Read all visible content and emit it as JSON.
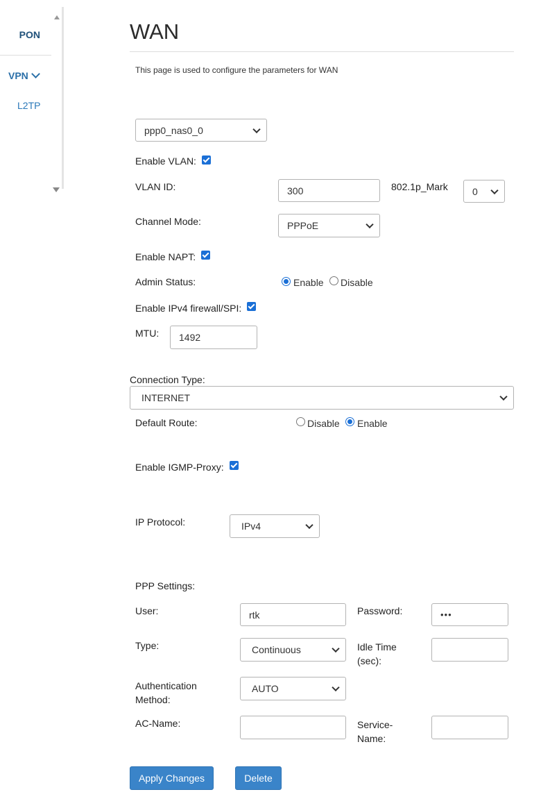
{
  "sidebar": {
    "pon": "PON",
    "vpn": "VPN",
    "l2tp": "L2TP"
  },
  "page": {
    "title": "WAN",
    "description": "This page is used to configure the parameters for WAN"
  },
  "form": {
    "wan_interface": "ppp0_nas0_0",
    "enable_vlan_label": "Enable VLAN:",
    "enable_vlan": true,
    "vlan_id_label": "VLAN ID:",
    "vlan_id": "300",
    "mark_label": "802.1p_Mark",
    "mark": "0",
    "channel_mode_label": "Channel Mode:",
    "channel_mode": "PPPoE",
    "enable_napt_label": "Enable NAPT:",
    "enable_napt": true,
    "admin_status_label": "Admin Status:",
    "admin_enable": "Enable",
    "admin_disable": "Disable",
    "enable_firewall_label": "Enable IPv4 firewall/SPI:",
    "enable_firewall": true,
    "mtu_label": "MTU:",
    "mtu": "1492",
    "connection_type_label": "Connection Type:",
    "connection_type": "INTERNET",
    "default_route_label": "Default Route:",
    "default_route_disable": "Disable",
    "default_route_enable": "Enable",
    "igmp_label": "Enable IGMP-Proxy:",
    "igmp": true,
    "ip_protocol_label": "IP Protocol:",
    "ip_protocol": "IPv4"
  },
  "ppp": {
    "section_label": "PPP Settings:",
    "user_label": "User:",
    "user": "rtk",
    "password_label": "Password:",
    "password_mask": "•••",
    "type_label": "Type:",
    "type": "Continuous",
    "idle_time_label_1": "Idle Time",
    "idle_time_label_2": "(sec):",
    "idle_time": "",
    "auth_label_1": "Authentication",
    "auth_label_2": "Method:",
    "auth": "AUTO",
    "ac_name_label": "AC-Name:",
    "ac_name": "",
    "service_name_label_1": "Service-",
    "service_name_label_2": "Name:",
    "service_name": ""
  },
  "buttons": {
    "apply": "Apply Changes",
    "delete": "Delete"
  },
  "colors": {
    "accent": "#1a6fd6",
    "button": "#3a84c9",
    "sidebar_link": "#2a78b8"
  }
}
